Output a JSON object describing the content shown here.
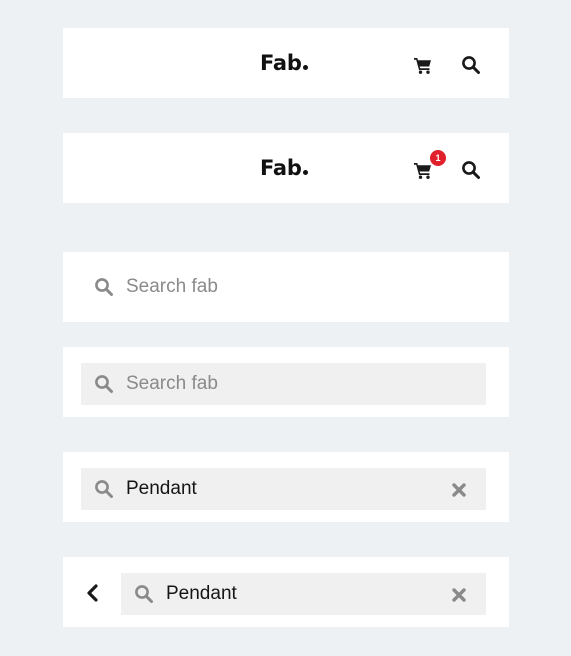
{
  "header": {
    "logo_text": "Fab",
    "cart_badge": "1"
  },
  "search_bars": {
    "placeholder_1": "Search fab",
    "placeholder_2": "Search fab",
    "value_1": "Pendant",
    "value_2": "Pendant"
  },
  "icons": [
    "cart-icon",
    "search-icon",
    "clear-icon",
    "chevron-left-icon"
  ],
  "colors": {
    "background": "#edf1f3",
    "card": "#ffffff",
    "field_background": "#f0f0f0",
    "badge": "#e0202b",
    "placeholder": "#8a8a8a",
    "icon_gray": "#8a8a8a"
  }
}
